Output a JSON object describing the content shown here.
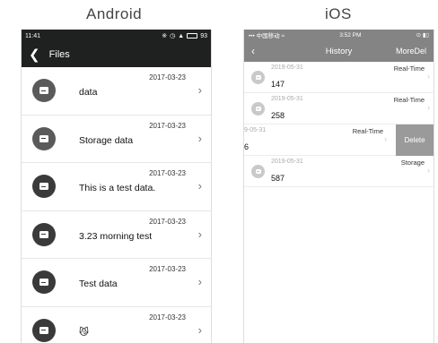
{
  "labels": {
    "android": "Android",
    "ios": "iOS"
  },
  "android": {
    "status": {
      "time": "11:41",
      "battery": "93"
    },
    "toolbar": {
      "title": "Files"
    },
    "items": [
      {
        "date": "2017-03-23",
        "name": "data"
      },
      {
        "date": "2017-03-23",
        "name": "Storage data"
      },
      {
        "date": "2017-03-23",
        "name": "This is a test data."
      },
      {
        "date": "2017-03-23",
        "name": "3.23  morning test"
      },
      {
        "date": "2017-03-23",
        "name": "Test data"
      },
      {
        "date": "2017-03-23",
        "name": "😼"
      }
    ]
  },
  "ios": {
    "status": {
      "carrier": "中国移动",
      "time": "3:52 PM"
    },
    "nav": {
      "title": "History",
      "right": "MoreDel"
    },
    "rows": [
      {
        "date": "2019-05-31",
        "type": "Real-Time",
        "value": "147"
      },
      {
        "date": "2019-05-31",
        "type": "Real-Time",
        "value": "258"
      },
      {
        "date": "9-05-31",
        "type": "Real-Time",
        "value": "6"
      },
      {
        "date": "2019-05-31",
        "type": "Storage",
        "value": "587"
      }
    ],
    "delete_label": "Delete"
  },
  "colors": {
    "android_bar": "#1f2020",
    "ios_bar": "#848484",
    "delete_bg": "#9a9a9a"
  }
}
